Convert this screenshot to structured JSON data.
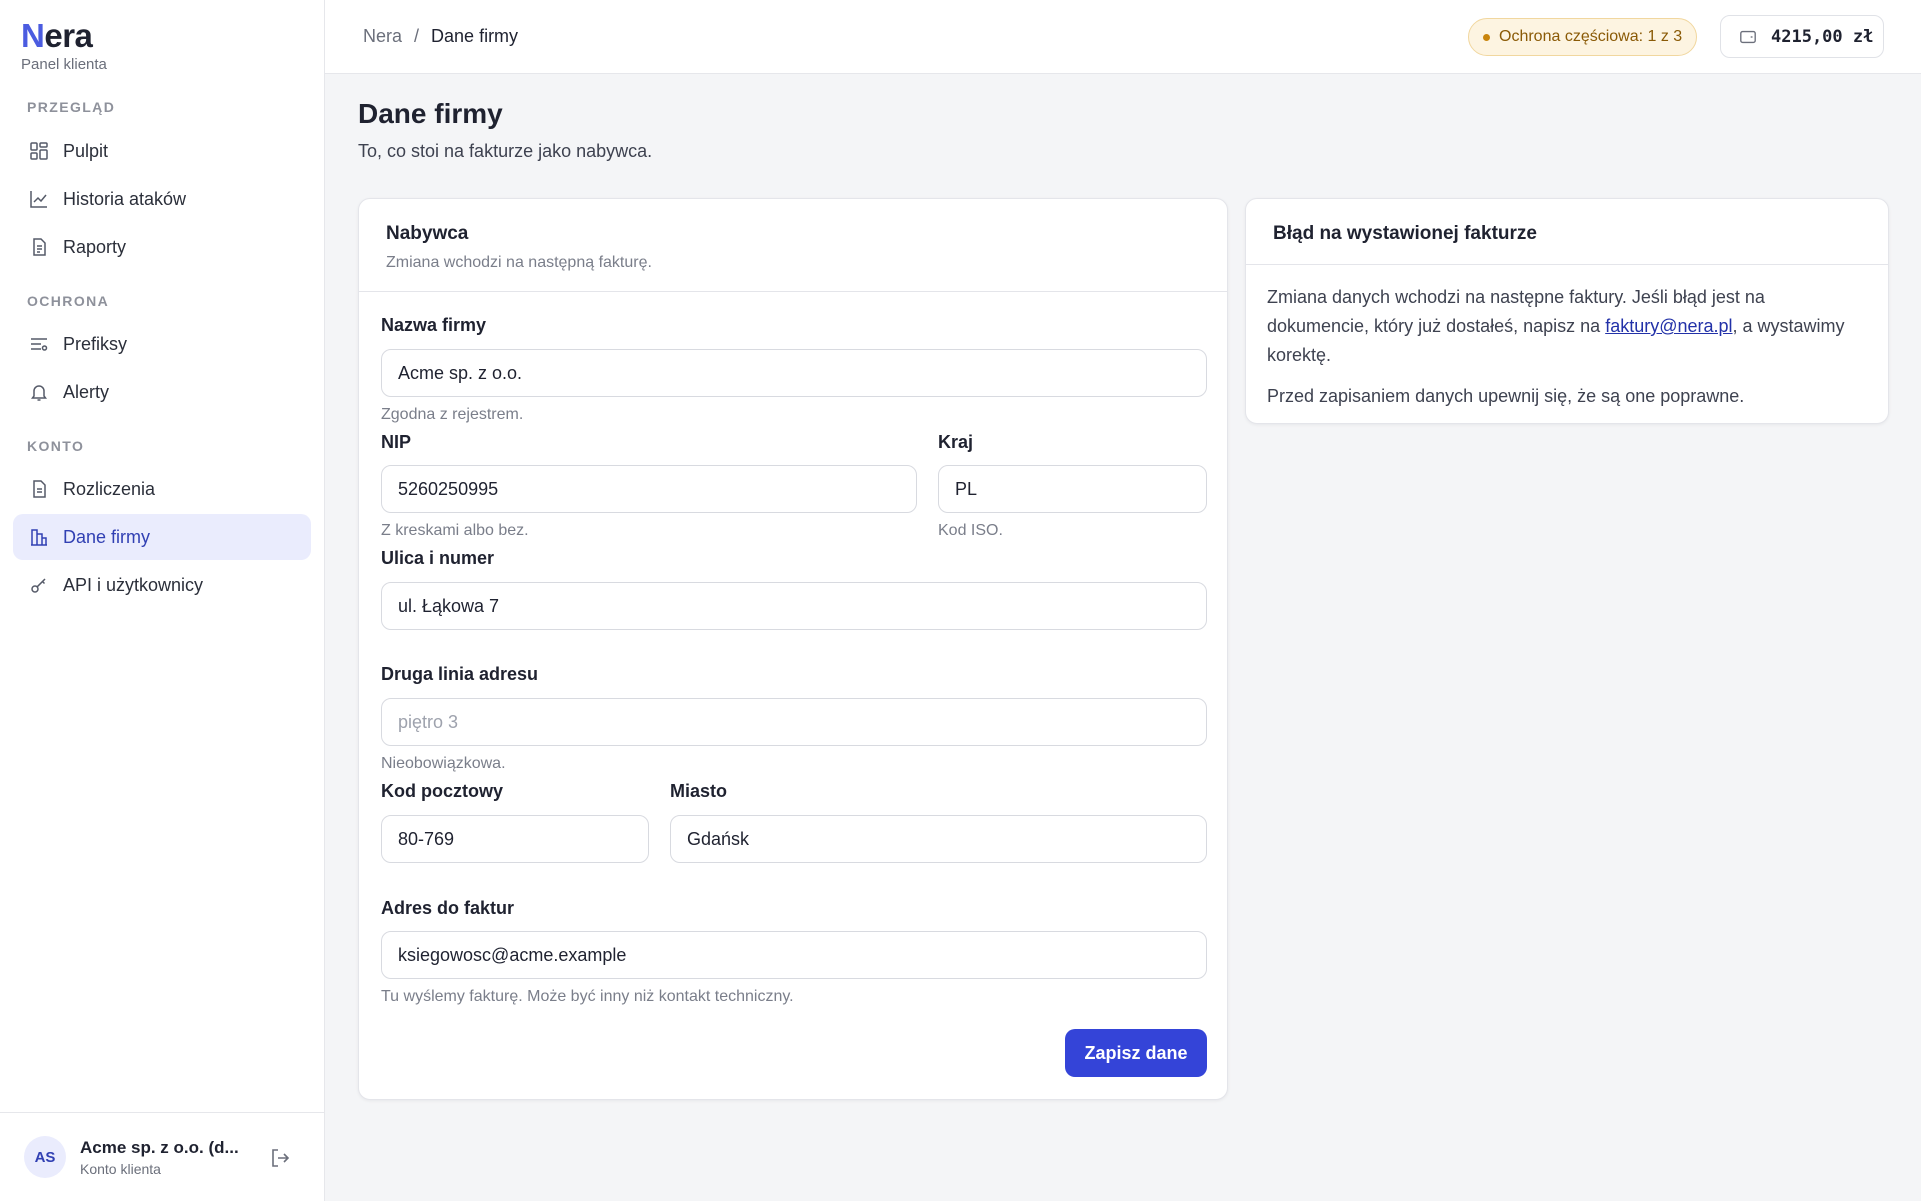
{
  "brand": {
    "logo_initial": "N",
    "logo_rest": "era",
    "subtitle": "Panel klienta"
  },
  "sidebar": {
    "sections": [
      {
        "label": "PRZEGLĄD"
      },
      {
        "label": "OCHRONA"
      },
      {
        "label": "KONTO"
      }
    ],
    "items": [
      {
        "label": "Pulpit",
        "icon": "grid-icon"
      },
      {
        "label": "Historia ataków",
        "icon": "chart-line-icon"
      },
      {
        "label": "Raporty",
        "icon": "document-icon"
      },
      {
        "label": "Prefiksy",
        "icon": "list-filter-icon"
      },
      {
        "label": "Alerty",
        "icon": "bell-icon"
      },
      {
        "label": "Rozliczenia",
        "icon": "receipt-icon"
      },
      {
        "label": "Dane firmy",
        "icon": "building-icon",
        "active": true
      },
      {
        "label": "API i użytkownicy",
        "icon": "key-icon"
      }
    ]
  },
  "user": {
    "initials": "AS",
    "name": "Acme sp. z o.o. (d...",
    "role": "Konto klienta"
  },
  "topbar": {
    "breadcrumb": [
      "Nera",
      "Dane firmy"
    ],
    "breadcrumb_separator": "/",
    "protection_badge": "Ochrona częściowa: 1 z 3",
    "balance": "4215,00 zł"
  },
  "page": {
    "title": "Dane firmy",
    "subtitle": "To, co stoi na fakturze jako nabywca."
  },
  "buyer_card": {
    "title": "Nabywca",
    "description": "Zmiana wchodzi na następną fakturę.",
    "fields": {
      "company_name": {
        "label": "Nazwa firmy",
        "value": "Acme sp. z o.o.",
        "hint": "Zgodna z rejestrem."
      },
      "nip": {
        "label": "NIP",
        "value": "5260250995",
        "hint": "Z kreskami albo bez."
      },
      "country": {
        "label": "Kraj",
        "value": "PL",
        "hint": "Kod ISO."
      },
      "street": {
        "label": "Ulica i numer",
        "value": "ul. Łąkowa 7"
      },
      "address2": {
        "label": "Druga linia adresu",
        "value": "",
        "placeholder": "piętro 3",
        "hint": "Nieobowiązkowa."
      },
      "postal_code": {
        "label": "Kod pocztowy",
        "value": "80-769"
      },
      "city": {
        "label": "Miasto",
        "value": "Gdańsk"
      },
      "invoice_email": {
        "label": "Adres do faktur",
        "value": "ksiegowosc@acme.example",
        "hint": "Tu wyślemy fakturę. Może być inny niż kontakt techniczny."
      }
    },
    "save_label": "Zapisz dane"
  },
  "error_card": {
    "title": "Błąd na wystawionej fakturze",
    "p1_before": "Zmiana danych wchodzi na następne faktury. Jeśli błąd jest na dokumencie, który już dostałeś, napisz na ",
    "email_link": "faktury@nera.pl",
    "p1_after": ", a wystawimy korektę.",
    "p2": "Przed zapisaniem danych upewnij się, że są one poprawne."
  },
  "colors": {
    "accent": "#3444d8",
    "active_bg": "#eaecfd",
    "badge_bg": "#fdf4e1",
    "badge_text": "#8a5a06"
  }
}
